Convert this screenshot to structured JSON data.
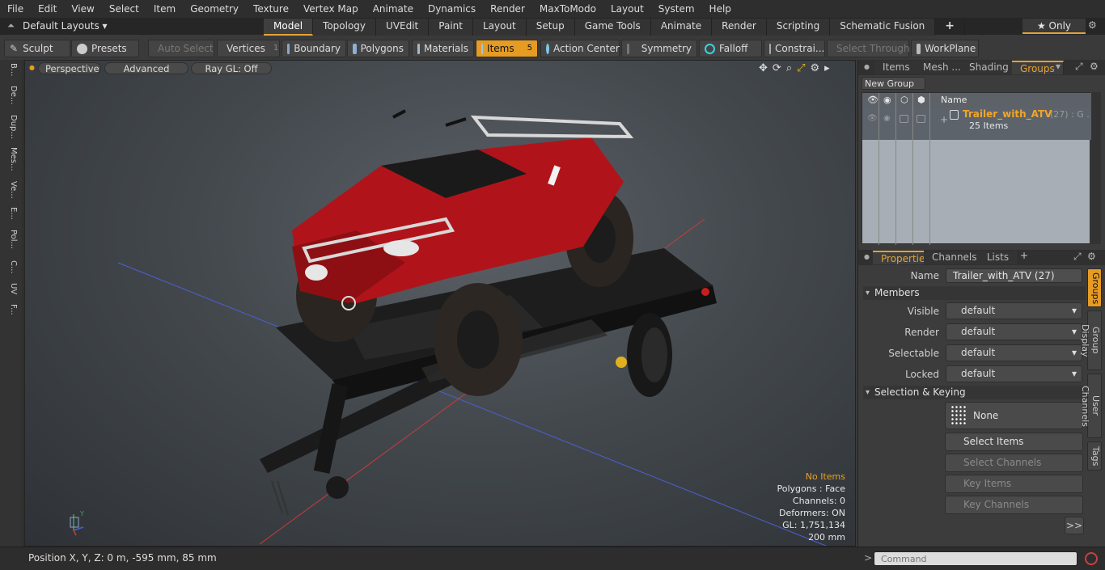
{
  "menu": [
    "File",
    "Edit",
    "View",
    "Select",
    "Item",
    "Geometry",
    "Texture",
    "Vertex Map",
    "Animate",
    "Dynamics",
    "Render",
    "MaxToModo",
    "Layout",
    "System",
    "Help"
  ],
  "layouts": {
    "label": "Default Layouts ▾",
    "tabs": [
      "Model",
      "Topology",
      "UVEdit",
      "Paint",
      "Layout",
      "Setup",
      "Game Tools",
      "Animate",
      "Render",
      "Scripting",
      "Schematic Fusion"
    ],
    "add_tab": "+",
    "only_label": "★  Only"
  },
  "toolbar": {
    "sculpt": "Sculpt",
    "presets": "Presets",
    "auto_select": "Auto Select",
    "vertices": "Vertices",
    "vertices_count": "1",
    "boundary": "Boundary",
    "polygons": "Polygons",
    "materials": "Materials",
    "items": "Items",
    "items_count": "5",
    "action_center": "Action Center",
    "symmetry": "Symmetry",
    "falloff": "Falloff",
    "constraints": "Constrai...",
    "select_through": "Select Through",
    "workplane": "WorkPlane"
  },
  "left_strip": [
    "B...",
    "De...",
    "Dup...",
    "Mes...",
    "Ve...",
    "E...",
    "Pol...",
    "C...",
    "UV",
    "F..."
  ],
  "viewport": {
    "view": "Perspective",
    "shading": "Advanced",
    "raygl": "Ray GL: Off",
    "stats": {
      "selection": "No Items",
      "polygons": "Polygons : Face",
      "channels": "Channels: 0",
      "deformers": "Deformers: ON",
      "gl": "GL: 1,751,134",
      "grid": "200 mm"
    },
    "colors": {
      "selection": "#e8a020",
      "x_axis": "#c83c3c",
      "z_axis": "#4b5fd0"
    }
  },
  "groups_panel": {
    "tabs": [
      "Items",
      "Mesh ...",
      "Shading",
      "Groups"
    ],
    "new_group": "New Group",
    "name_header": "Name",
    "group_name": "Trailer_with_ATV",
    "group_suffix": "(27) : G ...",
    "group_items": "25 Items"
  },
  "properties": {
    "tabs": [
      "Properties",
      "Channels",
      "Lists",
      "+"
    ],
    "name_label": "Name",
    "name_value": "Trailer_with_ATV (27)",
    "members": "Members",
    "fields": [
      {
        "label": "Visible",
        "value": "default"
      },
      {
        "label": "Render",
        "value": "default"
      },
      {
        "label": "Selectable",
        "value": "default"
      },
      {
        "label": "Locked",
        "value": "default"
      }
    ],
    "selection_keying": "Selection & Keying",
    "none_btn": "None",
    "select_items": "Select Items",
    "select_channels": "Select Channels",
    "key_items": "Key Items",
    "key_channels": "Key Channels",
    "more": ">>",
    "side_tabs": [
      "Groups",
      "Group Display",
      "User Channels",
      "Tags"
    ]
  },
  "status": {
    "position": "Position X, Y, Z:   0 m, -595 mm, 85 mm",
    "command_placeholder": "Command"
  }
}
